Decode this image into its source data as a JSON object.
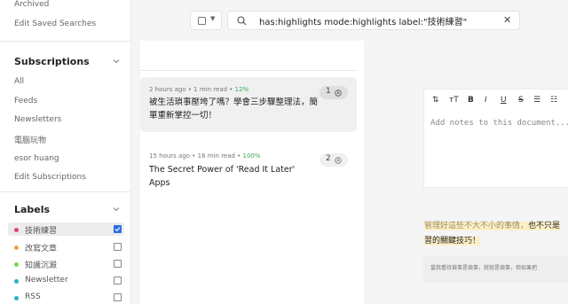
{
  "sidebar": {
    "top_links": [
      "Archived",
      "Edit Saved Searches"
    ],
    "subscriptions": {
      "heading": "Subscriptions",
      "items": [
        "All",
        "Feeds",
        "Newsletters",
        "電腦玩物",
        "esor huang",
        "Edit Subscriptions"
      ]
    },
    "labels": {
      "heading": "Labels",
      "items": [
        {
          "name": "技術練習",
          "color": "#e0457b",
          "checked": true
        },
        {
          "name": "改寫文章",
          "color": "#f0a040",
          "checked": false
        },
        {
          "name": "知識沉澱",
          "color": "#7ad84f",
          "checked": false
        },
        {
          "name": "Newsletter",
          "color": "#27b2c6",
          "checked": false
        },
        {
          "name": "RSS",
          "color": "#27b2c6",
          "checked": false
        }
      ]
    }
  },
  "search": {
    "query": "has:highlights mode:highlights label:\"技術練習\"",
    "clear_symbol": "✕",
    "select_caret": "▼"
  },
  "cards": [
    {
      "meta_prefix": "2 hours ago • 1 min read • ",
      "progress": "12%",
      "title": "被生活瑣事壓垮了嗎？學會三步驟整理法，簡單重新掌控一切！",
      "highlight_count": "1"
    },
    {
      "meta_prefix": "15 hours ago • 16 min read • ",
      "progress": "100%",
      "title": "The Secret Power of 'Read It Later' Apps",
      "highlight_count": "2"
    }
  ],
  "notes": {
    "toolbar": [
      "⇅",
      "тT",
      "B",
      "I",
      "U",
      "S",
      "☰",
      "☷"
    ],
    "placeholder": "Add notes to this document..."
  },
  "highlight": {
    "line1_muted": "管理好這些不大不小的事情，",
    "line1_strong": "也不只是",
    "line2": "習的關鍵技巧！"
  },
  "quote": {
    "text": "當我看待瑣事是瑣事，就就是瑣事，但如果把"
  },
  "colors": {
    "accent": "#2f6fe4",
    "progress_green": "#3aa856",
    "highlight_bg": "#fcefc7"
  }
}
